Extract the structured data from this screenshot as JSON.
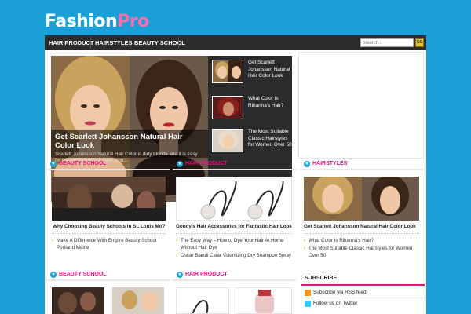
{
  "logo": {
    "part1": "Fashion",
    "part2": "Pro"
  },
  "nav": {
    "items": [
      "HAIR PRODUCT",
      "HAIRSTYLES",
      "BEAUTY SCHOOL"
    ]
  },
  "search": {
    "placeholder": "Search...",
    "button": "GO"
  },
  "slider": {
    "title": "Get Scarlett Johansson Natural Hair Color Look",
    "excerpt": "Scarlett Johansson Natural Hair Color is dirty blonde and it is easy for her to change hair color. You...",
    "thumbs": [
      "Get Scarlett Johansson Natural Hair Color Look",
      "What Color Is Rihanna's Hair?",
      "The Most Suitable Classic Hairstyles for Women Over 50"
    ]
  },
  "sections": [
    {
      "title": "BEAUTY SCHOOL",
      "post": "Why Choosing Beauty Schools In St. Louis Mo?",
      "links": [
        "Make A Difference With Empire Beauty School Portland Maine"
      ]
    },
    {
      "title": "HAIR PRODUCT",
      "post": "Goody's Hair Accessories for Fantastic Hair Look",
      "links": [
        "The Easy Way – How to Dye Your Hair At Home Without Hair Dye",
        "Oscar Blandi Clear Volumizing Dry Shampoo Spray"
      ]
    },
    {
      "title": "HAIRSTYLES",
      "post": "Get Scarlett Johansson Natural Hair Color Look",
      "links": [
        "What Color Is Rihanna's Hair?",
        "The Most Suitable Classic Hairstyles for Women Over 50"
      ]
    }
  ],
  "sections_row2": [
    {
      "title": "BEAUTY SCHOOL"
    },
    {
      "title": "HAIR PRODUCT"
    }
  ],
  "subscribe": {
    "title": "SUBSCRIBE",
    "rss": "Subscribe via RSS feed",
    "twitter": "Follow us on Twitter"
  },
  "colors": {
    "background": "#1aa0d6",
    "accent": "#e0157e",
    "nav": "#2b2b2b"
  }
}
